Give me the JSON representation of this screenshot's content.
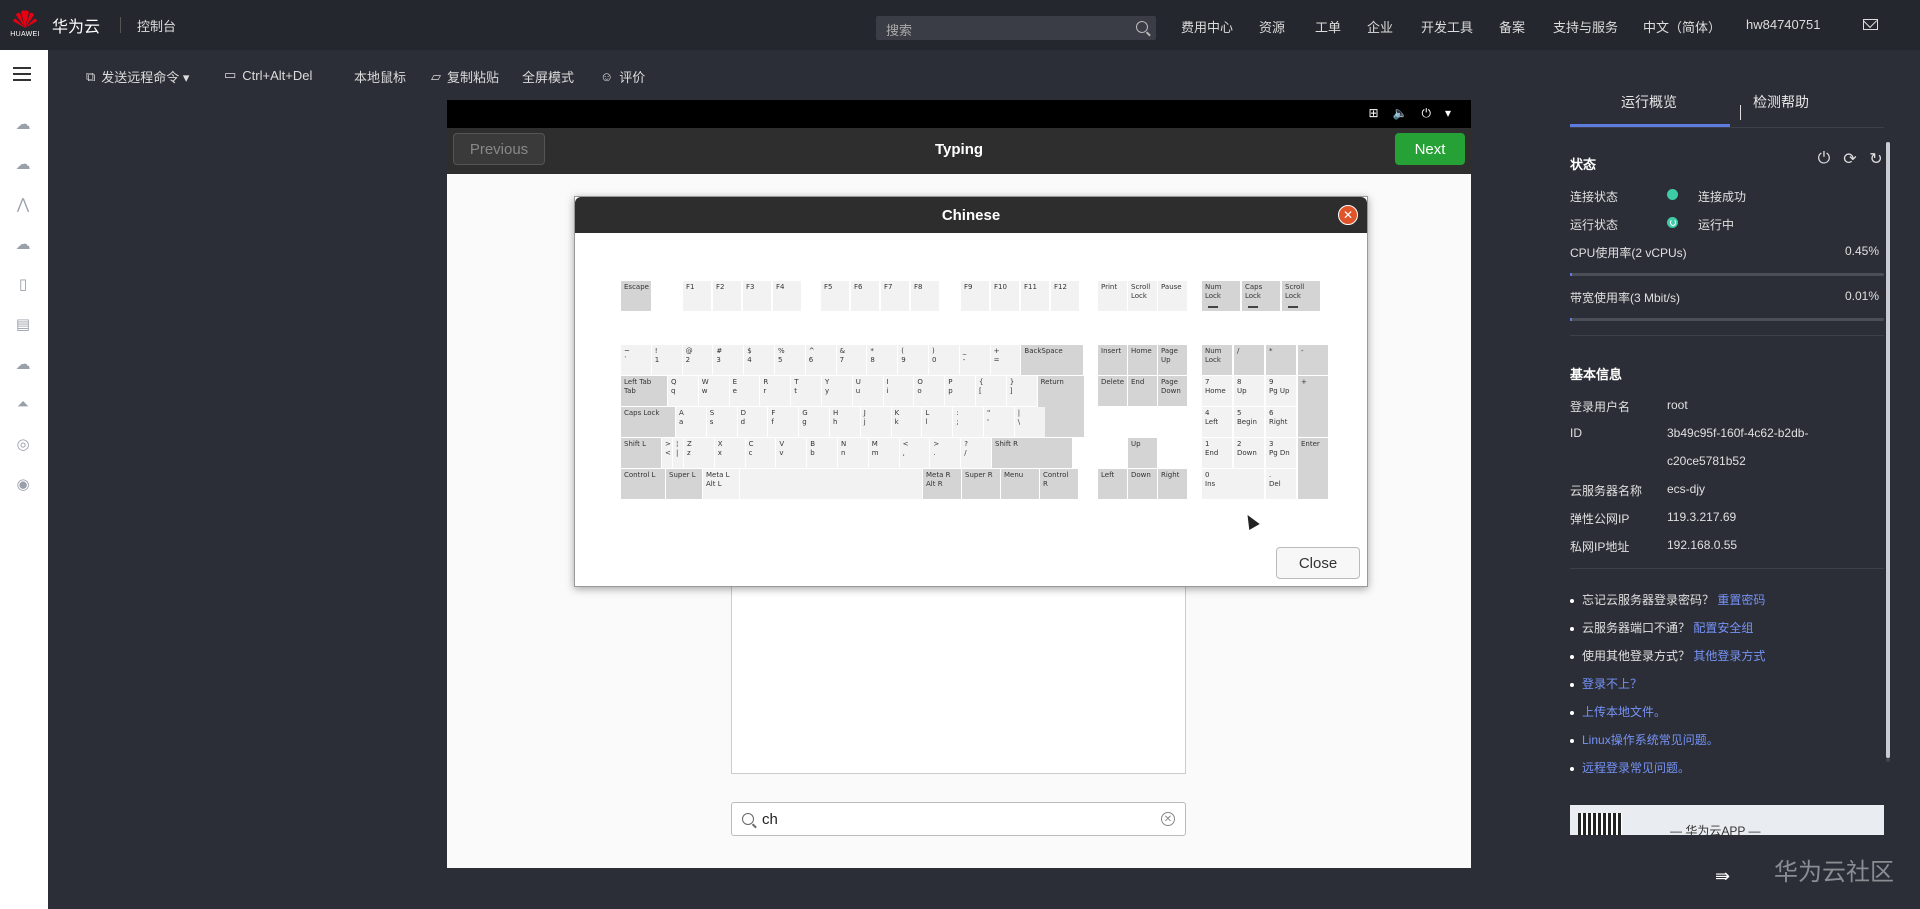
{
  "topbar": {
    "brand_sub": "HUAWEI",
    "brand": "华为云",
    "console": "控制台",
    "search_placeholder": "搜索",
    "nav": [
      "费用中心",
      "资源",
      "工单",
      "企业",
      "开发工具",
      "备案",
      "支持与服务",
      "中文（简体）",
      "hw84740751"
    ]
  },
  "toolbar": {
    "send_cmd": "发送远程命令 ▾",
    "ctrl_alt_del": "Ctrl+Alt+Del",
    "local_mouse": "本地鼠标",
    "copy_paste": "复制粘贴",
    "fullscreen": "全屏模式",
    "rate": "评价"
  },
  "vm": {
    "prev": "Previous",
    "title": "Typing",
    "next": "Next",
    "search_value": "ch",
    "clear_glyph": "✕"
  },
  "dialog": {
    "title": "Chinese",
    "close_x": "✕",
    "close_button": "Close"
  },
  "keyboard": [
    {
      "t": [
        "Escape"
      ],
      "g": true
    },
    {
      "t": [
        "F1"
      ]
    },
    {
      "t": [
        "F2"
      ]
    },
    {
      "t": [
        "F3"
      ]
    },
    {
      "t": [
        "F4"
      ]
    },
    {
      "t": [
        "F5"
      ]
    },
    {
      "t": [
        "F6"
      ]
    },
    {
      "t": [
        "F7"
      ]
    },
    {
      "t": [
        "F8"
      ]
    },
    {
      "t": [
        "F9"
      ]
    },
    {
      "t": [
        "F10"
      ]
    },
    {
      "t": [
        "F11"
      ]
    },
    {
      "t": [
        "F12"
      ]
    },
    {
      "t": [
        "Print"
      ]
    },
    {
      "t": [
        "Scroll",
        "Lock"
      ]
    },
    {
      "t": [
        "Pause"
      ]
    },
    {
      "t": [
        "Num",
        "Lock"
      ],
      "g": true,
      "led": true
    },
    {
      "t": [
        "Caps",
        "Lock"
      ],
      "g": true,
      "led": true
    },
    {
      "t": [
        "Scroll",
        "Lock"
      ],
      "g": true,
      "led": true
    },
    {
      "t": [
        "~",
        "`"
      ]
    },
    {
      "t": [
        "!",
        "1"
      ]
    },
    {
      "t": [
        "@",
        "2"
      ]
    },
    {
      "t": [
        "#",
        "3"
      ]
    },
    {
      "t": [
        "$",
        "4"
      ]
    },
    {
      "t": [
        "%",
        "5"
      ]
    },
    {
      "t": [
        "^",
        "6"
      ]
    },
    {
      "t": [
        "&",
        "7"
      ]
    },
    {
      "t": [
        "*",
        "8"
      ]
    },
    {
      "t": [
        "(",
        "9"
      ]
    },
    {
      "t": [
        ")",
        "0"
      ]
    },
    {
      "t": [
        "_",
        "-"
      ]
    },
    {
      "t": [
        "+",
        "="
      ]
    },
    {
      "t": [
        "BackSpace"
      ],
      "g": true
    },
    {
      "t": [
        "Insert"
      ],
      "g": true
    },
    {
      "t": [
        "Home"
      ],
      "g": true
    },
    {
      "t": [
        "Page",
        "Up"
      ],
      "g": true
    },
    {
      "t": [
        "Num",
        "Lock"
      ],
      "g": true
    },
    {
      "t": [
        "/"
      ],
      "g": true
    },
    {
      "t": [
        "*"
      ],
      "g": true
    },
    {
      "t": [
        "-"
      ],
      "g": true
    },
    {
      "t": [
        "Left Tab",
        "Tab"
      ],
      "g": true
    },
    {
      "t": [
        "Q",
        "q"
      ]
    },
    {
      "t": [
        "W",
        "w"
      ]
    },
    {
      "t": [
        "E",
        "e"
      ]
    },
    {
      "t": [
        "R",
        "r"
      ]
    },
    {
      "t": [
        "T",
        "t"
      ]
    },
    {
      "t": [
        "Y",
        "y"
      ]
    },
    {
      "t": [
        "U",
        "u"
      ]
    },
    {
      "t": [
        "I",
        "i"
      ]
    },
    {
      "t": [
        "O",
        "o"
      ]
    },
    {
      "t": [
        "P",
        "p"
      ]
    },
    {
      "t": [
        "{",
        "["
      ]
    },
    {
      "t": [
        "}",
        "]"
      ]
    },
    {
      "t": [
        "Return"
      ],
      "g": true
    },
    {
      "t": [
        "Delete"
      ],
      "g": true
    },
    {
      "t": [
        "End"
      ],
      "g": true
    },
    {
      "t": [
        "Page",
        "Down"
      ],
      "g": true
    },
    {
      "t": [
        "7",
        "Home"
      ]
    },
    {
      "t": [
        "8",
        "Up"
      ]
    },
    {
      "t": [
        "9",
        "Pg Up"
      ]
    },
    {
      "t": [
        "+"
      ],
      "g": true
    },
    {
      "t": [
        "Caps Lock"
      ],
      "g": true
    },
    {
      "t": [
        "A",
        "a"
      ]
    },
    {
      "t": [
        "S",
        "s"
      ]
    },
    {
      "t": [
        "D",
        "d"
      ]
    },
    {
      "t": [
        "F",
        "f"
      ]
    },
    {
      "t": [
        "G",
        "g"
      ]
    },
    {
      "t": [
        "H",
        "h"
      ]
    },
    {
      "t": [
        "J",
        "j"
      ]
    },
    {
      "t": [
        "K",
        "k"
      ]
    },
    {
      "t": [
        "L",
        "l"
      ]
    },
    {
      "t": [
        ":",
        ";"
      ]
    },
    {
      "t": [
        "\"",
        "'"
      ]
    },
    {
      "t": [
        "|",
        "\\"
      ]
    },
    {
      "t": [
        "4",
        "Left"
      ]
    },
    {
      "t": [
        "5",
        "Begin"
      ]
    },
    {
      "t": [
        "6",
        "Right"
      ]
    },
    {
      "t": [
        "Shift L"
      ],
      "g": true
    },
    {
      "t": [
        ">",
        "<"
      ]
    },
    {
      "t": [
        "¦",
        "|"
      ]
    },
    {
      "t": [
        "Z",
        "z"
      ]
    },
    {
      "t": [
        "X",
        "x"
      ]
    },
    {
      "t": [
        "C",
        "c"
      ]
    },
    {
      "t": [
        "V",
        "v"
      ]
    },
    {
      "t": [
        "B",
        "b"
      ]
    },
    {
      "t": [
        "N",
        "n"
      ]
    },
    {
      "t": [
        "M",
        "m"
      ]
    },
    {
      "t": [
        "<",
        ","
      ]
    },
    {
      "t": [
        ">",
        "."
      ]
    },
    {
      "t": [
        "?",
        "/"
      ]
    },
    {
      "t": [
        "Shift R"
      ],
      "g": true
    },
    {
      "t": [
        "Up"
      ],
      "g": true
    },
    {
      "t": [
        "1",
        "End"
      ]
    },
    {
      "t": [
        "2",
        "Down"
      ]
    },
    {
      "t": [
        "3",
        "Pg Dn"
      ]
    },
    {
      "t": [
        "Enter"
      ],
      "g": true
    },
    {
      "t": [
        "Control L"
      ],
      "g": true
    },
    {
      "t": [
        "Super L"
      ],
      "g": true
    },
    {
      "t": [
        "Meta L",
        "Alt L"
      ]
    },
    {
      "t": [
        ""
      ]
    },
    {
      "t": [
        "Meta R",
        "Alt R"
      ],
      "g": true
    },
    {
      "t": [
        "Super R"
      ],
      "g": true
    },
    {
      "t": [
        "Menu"
      ],
      "g": true
    },
    {
      "t": [
        "Control R"
      ],
      "g": true
    },
    {
      "t": [
        "Left"
      ],
      "g": true
    },
    {
      "t": [
        "Down"
      ],
      "g": true
    },
    {
      "t": [
        "Right"
      ],
      "g": true
    },
    {
      "t": [
        "0",
        "Ins"
      ]
    },
    {
      "t": [
        ".",
        "Del"
      ]
    }
  ],
  "right_panel": {
    "tab_overview": "运行概览",
    "tab_help": "检测帮助",
    "status_heading": "状态",
    "conn_label": "连接状态",
    "conn_value": "连接成功",
    "run_label": "运行状态",
    "run_value": "运行中",
    "cpu_label": "CPU使用率(2 vCPUs)",
    "cpu_value": "0.45%",
    "cpu_fraction": 0.0045,
    "bw_label": "带宽使用率(3 Mbit/s)",
    "bw_value": "0.01%",
    "bw_fraction": 0.0001,
    "basic_heading": "基本信息",
    "user_label": "登录用户名",
    "user_value": "root",
    "id_label": "ID",
    "id_value_1": "3b49c95f-160f-4c62-b2db-",
    "id_value_2": "c20ce5781b52",
    "name_label": "云服务器名称",
    "name_value": "ecs-djy",
    "eip_label": "弹性公网IP",
    "eip_value": "119.3.217.69",
    "pip_label": "私网IP地址",
    "pip_value": "192.168.0.55",
    "tips": [
      {
        "q": "忘记云服务器登录密码？",
        "link": "重置密码"
      },
      {
        "q": "云服务器端口不通？",
        "link": "配置安全组"
      },
      {
        "q": "使用其他登录方式？",
        "link": "其他登录方式"
      },
      {
        "q": "",
        "link": "登录不上？"
      },
      {
        "q": "",
        "link": "上传本地文件。"
      },
      {
        "q": "",
        "link": "Linux操作系统常见问题。"
      },
      {
        "q": "",
        "link": "远程登录常见问题。"
      }
    ],
    "app_banner": "— 华为云APP —",
    "collapse_glyph": "⇛"
  },
  "watermark": "华为云社区",
  "colors": {
    "accent": "#5e7ce0",
    "green": "#26a136",
    "status_ok": "#3dcca6",
    "link": "#7693f5"
  }
}
